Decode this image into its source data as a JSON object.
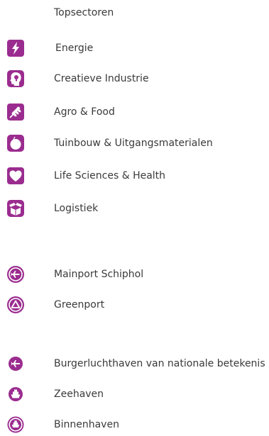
{
  "legend": {
    "title": "Topsectoren",
    "accent_color": "#9b2c8f",
    "topsectoren": [
      {
        "label": "Energie",
        "icon": "lightning-icon"
      },
      {
        "label": "Creatieve Industrie",
        "icon": "head-lightbulb-icon"
      },
      {
        "label": "Agro & Food",
        "icon": "wheat-icon"
      },
      {
        "label": "Tuinbouw & Uitgangsmaterialen",
        "icon": "apple-icon"
      },
      {
        "label": "Life Sciences & Health",
        "icon": "heart-icon"
      },
      {
        "label": "Logistiek",
        "icon": "box-icon"
      }
    ],
    "mainports": [
      {
        "label": "Mainport Schiphol",
        "icon": "airplane-circle-icon"
      },
      {
        "label": "Greenport",
        "icon": "triangle-circle-icon"
      }
    ],
    "havens": [
      {
        "label": "Burgerluchthaven van nationale betekenis",
        "icon": "airplane-icon"
      },
      {
        "label": "Zeehaven",
        "icon": "ship-icon"
      },
      {
        "label": "Binnenhaven",
        "icon": "ship-circle-icon"
      }
    ]
  }
}
